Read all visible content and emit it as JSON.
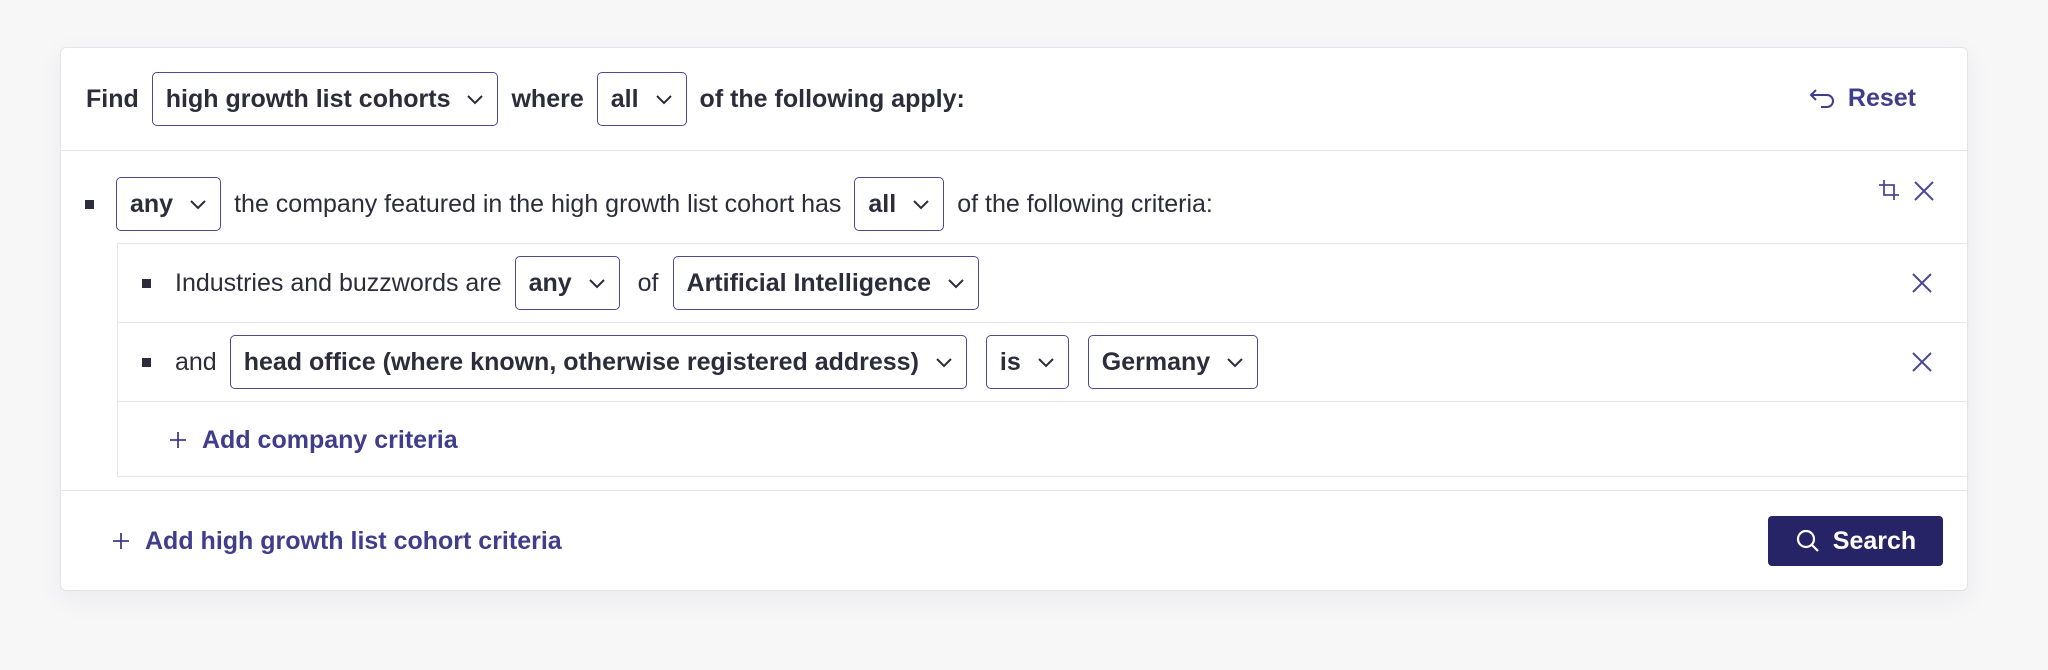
{
  "header": {
    "find_label": "Find",
    "entity_select": "high growth list cohorts",
    "where_label": "where",
    "match_select": "all",
    "apply_label": "of the following apply:",
    "reset_label": "Reset"
  },
  "group": {
    "quantifier_select": "any",
    "description": "the company featured in the high growth list cohort has",
    "match_select": "all",
    "tail": "of the following criteria:",
    "icons": [
      "crop-icon",
      "close-icon"
    ]
  },
  "criteria": [
    {
      "lead": "Industries and buzzwords are",
      "operator_select": "any",
      "connector": "of",
      "value_select": "Artificial Intelligence"
    },
    {
      "lead": "and",
      "field_select": "head office (where known, otherwise registered address)",
      "operator_select": "is",
      "value_select": "Germany"
    }
  ],
  "add_company_criteria": "Add company criteria",
  "footer": {
    "add_cohort_criteria": "Add high growth list cohort criteria",
    "search_label": "Search"
  },
  "colors": {
    "accent": "#3f3d8c",
    "button_bg": "#262467",
    "border": "#4b4993"
  }
}
